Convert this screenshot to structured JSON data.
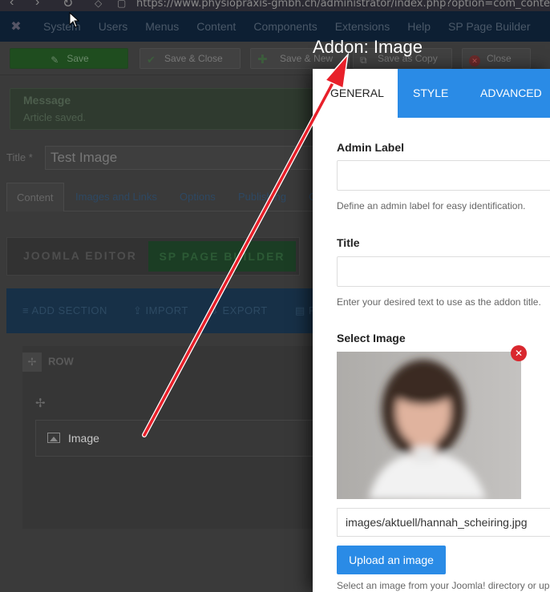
{
  "browser": {
    "url": "https://www.physiopraxis-gmbh.ch/administrator/index.php?option=com_content&v"
  },
  "admin_menu": {
    "items": [
      "System",
      "Users",
      "Menus",
      "Content",
      "Components",
      "Extensions",
      "Help",
      "SP Page Builder"
    ]
  },
  "toolbar": {
    "save": "Save",
    "save_close": "Save & Close",
    "save_new": "Save & New",
    "save_copy": "Save as Copy",
    "close": "Close"
  },
  "message": {
    "heading": "Message",
    "text": "Article saved."
  },
  "article": {
    "title_label": "Title *",
    "title_value": "Test Image"
  },
  "article_tabs": [
    "Content",
    "Images and Links",
    "Options",
    "Publishing",
    "C"
  ],
  "editor_toggle": {
    "joomla": "JOOMLA EDITOR",
    "spb": "SP PAGE BUILDER"
  },
  "builder_bar": {
    "add_section": "ADD SECTION",
    "import": "IMPORT",
    "export": "EXPORT",
    "more": "P"
  },
  "builder": {
    "row_label": "ROW",
    "addon_label": "Image"
  },
  "annotation": {
    "title": "Addon: Image"
  },
  "modal": {
    "tabs": [
      "GENERAL",
      "STYLE",
      "ADVANCED"
    ],
    "admin_label": "Admin Label",
    "admin_label_help": "Define an admin label for easy identification.",
    "title_label": "Title",
    "title_help": "Enter your desired text to use as the addon title.",
    "image_label": "Select Image",
    "image_path": "images/aktuell/hannah_scheiring.jpg",
    "upload_button": "Upload an image",
    "image_help": "Select an image from your Joomla! directory or upload one."
  },
  "colors": {
    "modal_blue": "#2a8be6",
    "remove_red": "#d9272e",
    "arrow_red": "#e8202a"
  }
}
